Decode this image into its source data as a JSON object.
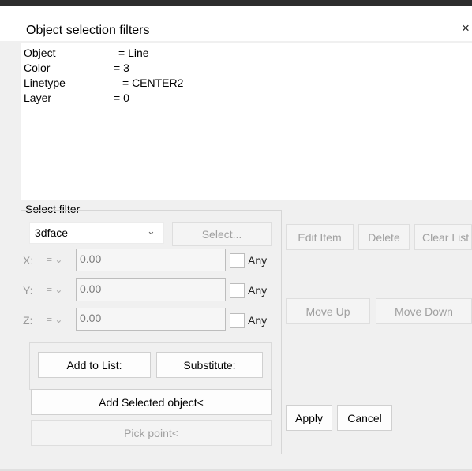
{
  "window": {
    "title": "Object selection filters",
    "close_glyph": "×"
  },
  "filter_list": [
    {
      "key": "Object",
      "value": "= Line"
    },
    {
      "key": "Color",
      "value": "= 3"
    },
    {
      "key": "Linetype",
      "value": "= CENTER2"
    },
    {
      "key": "Layer",
      "value": "= 0"
    }
  ],
  "select_filter": {
    "group_label": "Select filter",
    "type_selected": "3dface",
    "select_button": "Select...",
    "axes": [
      {
        "label": "X:",
        "operator": "=",
        "value": "0.00",
        "any_label": "Any"
      },
      {
        "label": "Y:",
        "operator": "=",
        "value": "0.00",
        "any_label": "Any"
      },
      {
        "label": "Z:",
        "operator": "=",
        "value": "0.00",
        "any_label": "Any"
      }
    ],
    "add_to_list": "Add to List:",
    "substitute": "Substitute:",
    "add_selected_object": "Add Selected object<",
    "pick_point": "Pick point<"
  },
  "right_buttons": {
    "edit_item": "Edit Item",
    "delete": "Delete",
    "clear_list": "Clear List",
    "move_up": "Move Up",
    "move_down": "Move Down",
    "apply": "Apply",
    "cancel": "Cancel"
  }
}
